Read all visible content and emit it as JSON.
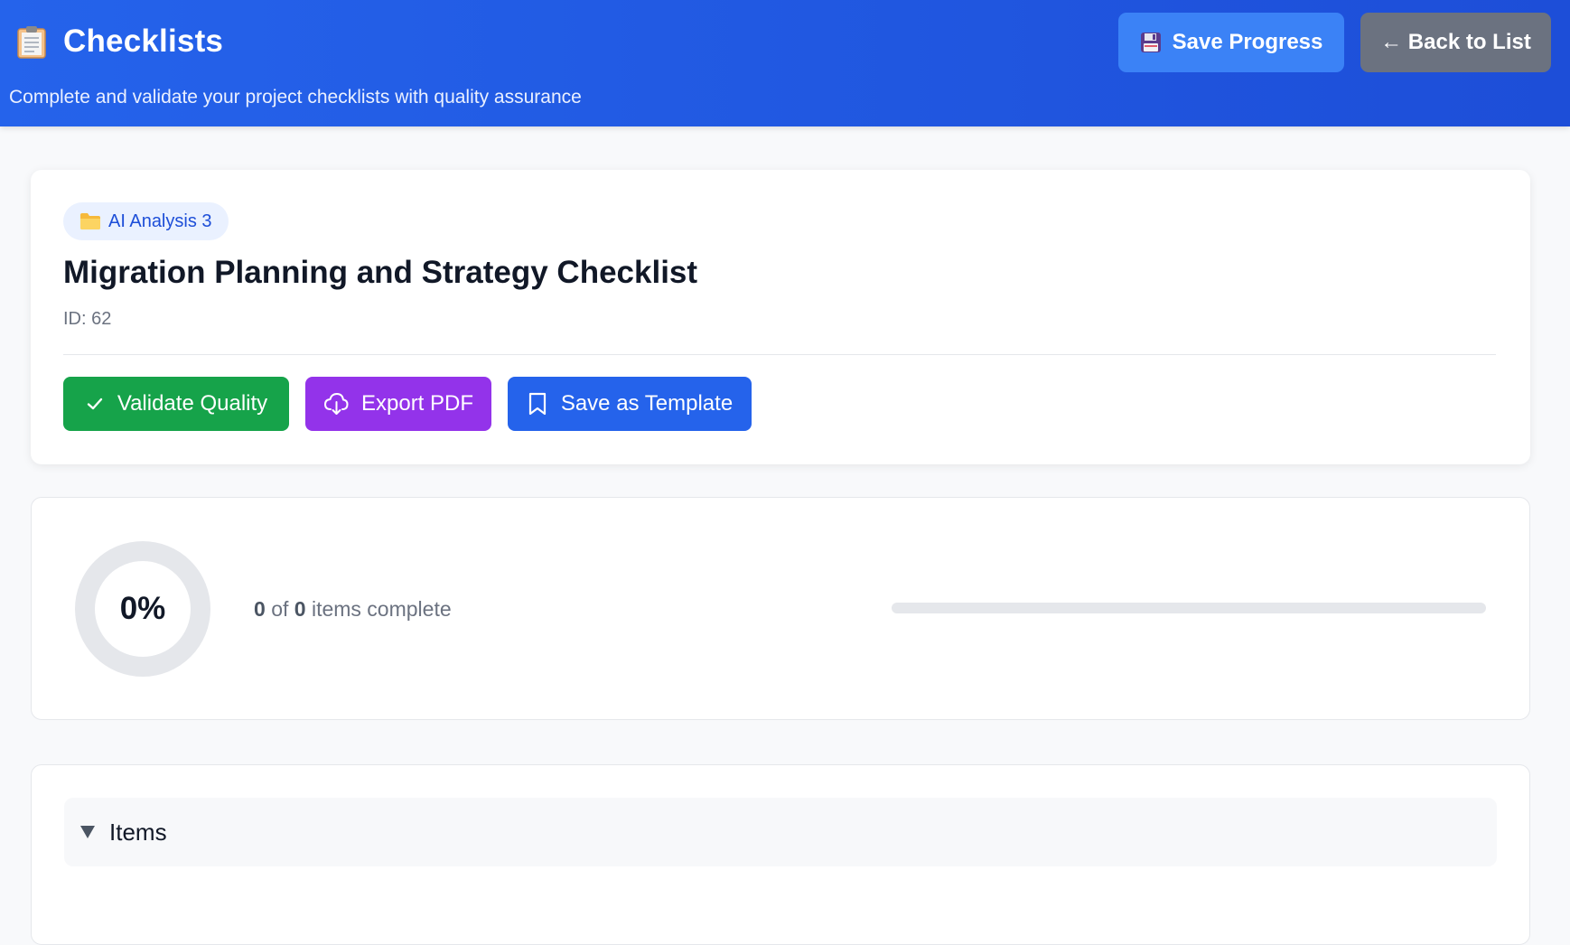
{
  "header": {
    "title": "Checklists",
    "subtitle": "Complete and validate your project checklists with quality assurance",
    "save_progress_label": "Save Progress",
    "back_label": "← Back to List",
    "colors": {
      "background": "#2563eb",
      "save_button": "#3b82f6",
      "back_button": "#6b7280"
    }
  },
  "checklist": {
    "project_badge": "AI Analysis 3",
    "title": "Migration Planning and Strategy Checklist",
    "id_text": "ID: 62",
    "actions": {
      "validate_label": "Validate Quality",
      "export_label": "Export PDF",
      "template_label": "Save as Template"
    },
    "colors": {
      "validate": "#16a34a",
      "export": "#9333ea",
      "template": "#2563eb"
    }
  },
  "progress": {
    "percent_label": "0%",
    "completed": "0",
    "total": "0",
    "of_text": "of",
    "suffix_text": "items complete",
    "fraction": 0
  },
  "items_section": {
    "label": "Items",
    "expanded": true
  }
}
